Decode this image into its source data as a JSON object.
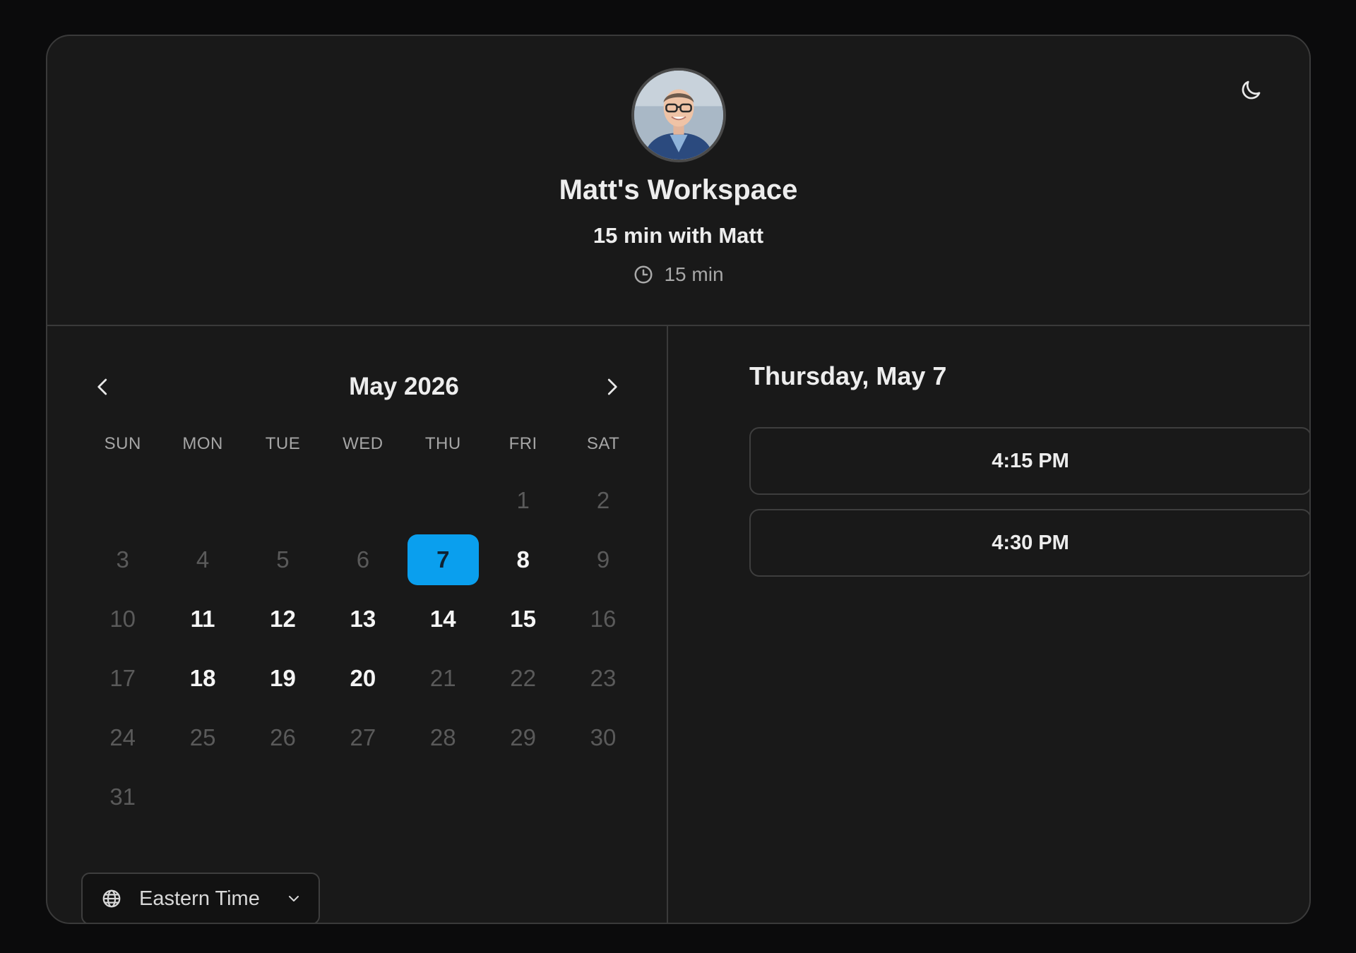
{
  "header": {
    "workspace_title": "Matt's Workspace",
    "event_title": "15 min with Matt",
    "duration": "15 min",
    "theme_toggle_icon": "moon-icon",
    "duration_icon": "clock-icon"
  },
  "calendar": {
    "month_label": "May 2026",
    "prev_icon": "chevron-left-icon",
    "next_icon": "chevron-right-icon",
    "weekdays": [
      "SUN",
      "MON",
      "TUE",
      "WED",
      "THU",
      "FRI",
      "SAT"
    ],
    "leading_blanks": 5,
    "days_in_month": 31,
    "available_days": [
      8,
      11,
      12,
      13,
      14,
      15,
      18,
      19,
      20
    ],
    "selected_day": 7,
    "selected_color": "#0a9fee"
  },
  "timezone": {
    "label": "Eastern Time",
    "icon": "globe-icon",
    "chevron_icon": "chevron-down-icon"
  },
  "slots": {
    "date_label": "Thursday, May 7",
    "times": [
      "4:15 PM",
      "4:30 PM"
    ]
  }
}
